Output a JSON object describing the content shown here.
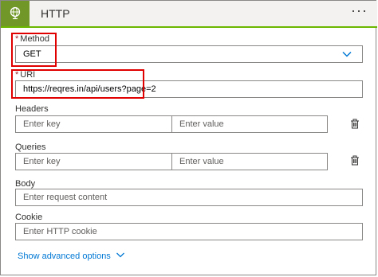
{
  "header": {
    "title": "HTTP",
    "more_label": "···",
    "icon": "globe-icon",
    "accent": "#709727"
  },
  "method": {
    "label": "Method",
    "required_mark": "*",
    "value": "GET",
    "icon": "chevron-down-icon"
  },
  "uri": {
    "label": "URI",
    "required_mark": "*",
    "value": "https://reqres.in/api/users?page=2"
  },
  "headers": {
    "label": "Headers",
    "key_placeholder": "Enter key",
    "value_placeholder": "Enter value",
    "icon": "delete-icon"
  },
  "queries": {
    "label": "Queries",
    "key_placeholder": "Enter key",
    "value_placeholder": "Enter value",
    "icon": "delete-icon"
  },
  "body": {
    "label": "Body",
    "placeholder": "Enter request content"
  },
  "cookie": {
    "label": "Cookie",
    "placeholder": "Enter HTTP cookie"
  },
  "advanced": {
    "label": "Show advanced options",
    "icon": "chevron-down-icon",
    "link_color": "#0078d4"
  },
  "highlight_color": "#e00000"
}
